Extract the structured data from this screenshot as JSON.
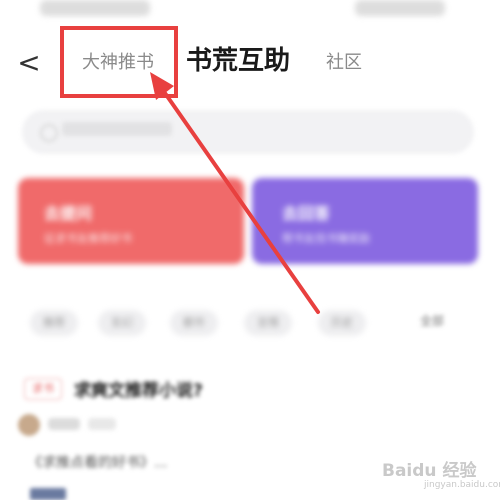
{
  "header": {
    "back_symbol": "<",
    "tabs": [
      {
        "label": "大神推书"
      },
      {
        "label": "书荒互助"
      },
      {
        "label": "社区"
      }
    ],
    "active_tab": "书荒互助"
  },
  "cards": [
    {
      "title": "去提问",
      "subtitle": "征求书友推荐好书",
      "color": "#f06a6a"
    },
    {
      "title": "去回答",
      "subtitle": "帮书友找书赚奖励",
      "color": "#8a6be2"
    }
  ],
  "chips": [
    "推荐",
    "玄幻",
    "都市",
    "言情",
    "历史"
  ],
  "more_label": "全部",
  "post": {
    "tag": "求书",
    "question": "求爽文推荐小说?",
    "answer": "《求推点看的好书》..."
  },
  "annotation": {
    "color": "#e8403f"
  },
  "watermark": {
    "text": "Baidu 经验",
    "sub": "jingyan.baidu.com"
  }
}
